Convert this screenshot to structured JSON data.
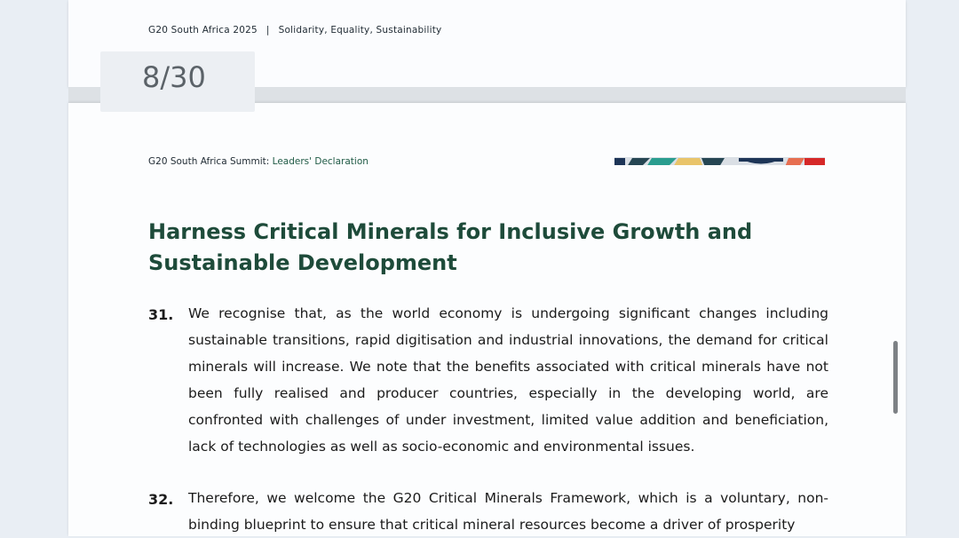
{
  "previous_page": {
    "header_left": "G20 South Africa 2025",
    "header_separator": "|",
    "header_right": "Solidarity, Equality, Sustainability"
  },
  "page_indicator": "8/30",
  "current_page": {
    "running_head_prefix": "G20 South Africa Summit: ",
    "running_head_highlight": "Leaders' Declaration",
    "title": "Harness Critical Minerals for Inclusive Growth and Sustainable Development",
    "paragraphs": [
      {
        "number": "31.",
        "text": "We recognise that, as the world economy is undergoing significant changes including sustainable transitions, rapid digitisation and industrial innovations, the demand for critical minerals will increase. We note that the benefits associated with critical minerals have not been fully realised and producer countries, especially in the developing world, are confronted with challenges of under investment, limited value addition and beneficiation, lack of technologies as well as socio-economic and environmental issues."
      },
      {
        "number": "32.",
        "text": "Therefore, we welcome the G20 Critical Minerals Framework, which is a voluntary, non-binding blueprint to ensure that critical mineral resources become a driver of prosperity"
      }
    ]
  },
  "colors": {
    "title_green": "#1e4b3a",
    "accent_green": "#1f5a45",
    "logo_colors": [
      "#1d3557",
      "#2a9d8f",
      "#e9c46a",
      "#c0392b",
      "#264653",
      "#d62828"
    ]
  }
}
